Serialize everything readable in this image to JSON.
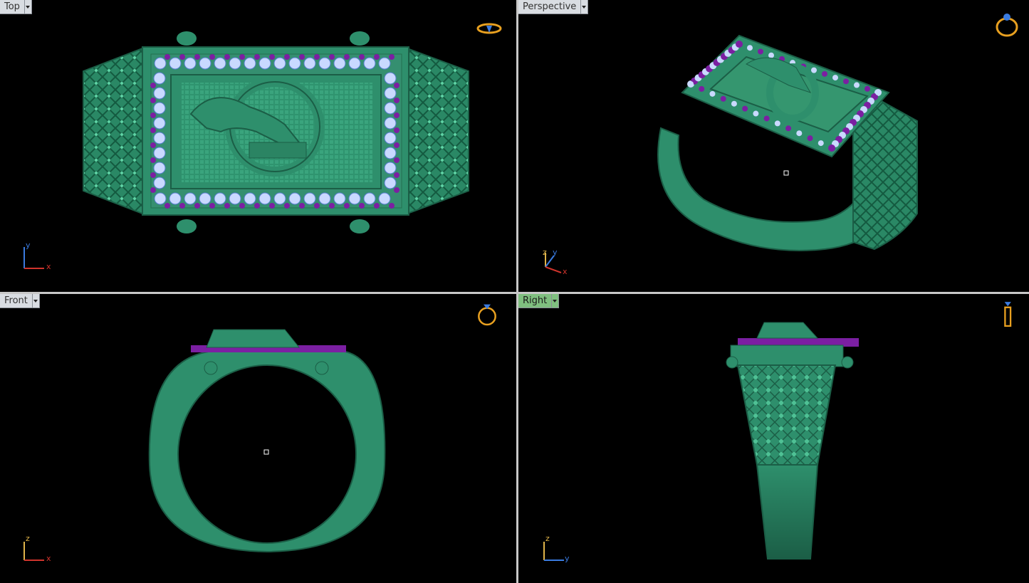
{
  "viewports": {
    "top": {
      "label": "Top",
      "axis_h": "x",
      "axis_v": "y"
    },
    "perspective": {
      "label": "Perspective",
      "axis_a": "z",
      "axis_b": "y",
      "axis_c": "x"
    },
    "front": {
      "label": "Front",
      "axis_h": "x",
      "axis_v": "z"
    },
    "right": {
      "label": "Right",
      "axis_h": "y",
      "axis_v": "z",
      "active": true
    }
  },
  "colors": {
    "metal": "#2e8f6c",
    "metal_dark": "#1b5e46",
    "metal_light": "#4fc195",
    "gem_light": "#c9d9ff",
    "gem_dark": "#7b1fa2",
    "axis_x": "#d0342c",
    "axis_y": "#3a7be0",
    "axis_z": "#e0b44a",
    "separator": "#c8c8c8",
    "tab_bg": "#d9dde2",
    "tab_active": "#7fbf7f"
  }
}
